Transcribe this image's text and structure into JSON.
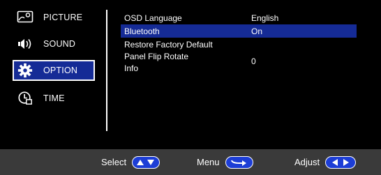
{
  "sidebar": {
    "items": [
      {
        "label": "PICTURE",
        "icon": "picture-icon"
      },
      {
        "label": "SOUND",
        "icon": "speaker-icon"
      },
      {
        "label": "OPTION",
        "icon": "gear-icon",
        "active": true
      },
      {
        "label": "TIME",
        "icon": "clock-icon"
      }
    ]
  },
  "settings": {
    "rows": [
      {
        "label": "OSD Language",
        "value": "English"
      },
      {
        "label": "Bluetooth",
        "value": "On",
        "selected": true
      },
      {
        "label": "Restore Factory Default",
        "value": ""
      },
      {
        "label": "Panel Flip Rotate",
        "value": "0"
      },
      {
        "label": "Info",
        "value": ""
      }
    ]
  },
  "footer": {
    "select_label": "Select",
    "menu_label": "Menu",
    "adjust_label": "Adjust"
  },
  "colors": {
    "background": "#000000",
    "highlight": "#152b96",
    "footer": "#3a3a3a",
    "key_pill": "#1d3ed6"
  }
}
